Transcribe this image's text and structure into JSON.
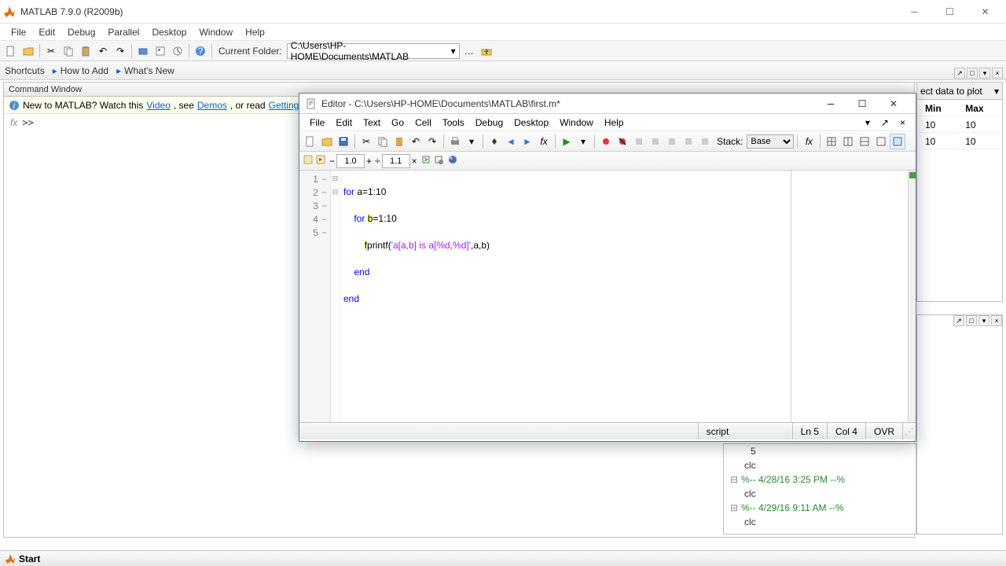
{
  "app": {
    "title": "MATLAB 7.9.0 (R2009b)"
  },
  "main_menu": [
    "File",
    "Edit",
    "Debug",
    "Parallel",
    "Desktop",
    "Window",
    "Help"
  ],
  "toolbar": {
    "current_folder_label": "Current Folder:",
    "current_folder_path": "C:\\Users\\HP-HOME\\Documents\\MATLAB"
  },
  "shortcuts": {
    "label": "Shortcuts",
    "how_to_add": "How to Add",
    "whats_new": "What's New"
  },
  "command_window": {
    "title": "Command Window",
    "info_prefix": "New to MATLAB? Watch this ",
    "info_video": "Video",
    "info_see": ", see ",
    "info_demos": "Demos",
    "info_or": ", or read ",
    "info_getting_started": "Getting Started",
    "info_period": ".",
    "prompt": ">>"
  },
  "right_panel": {
    "select_label": "ect data to plot",
    "cols": [
      "Min",
      "Max"
    ],
    "rows": [
      [
        "10",
        "10"
      ],
      [
        "10",
        "10"
      ]
    ]
  },
  "editor": {
    "title": "Editor - C:\\Users\\HP-HOME\\Documents\\MATLAB\\first.m*",
    "menu": [
      "File",
      "Edit",
      "Text",
      "Go",
      "Cell",
      "Tools",
      "Debug",
      "Desktop",
      "Window",
      "Help"
    ],
    "stack_label": "Stack:",
    "stack_value": "Base",
    "zoom1": "1.0",
    "zoom2": "1.1",
    "code": {
      "lines": [
        {
          "n": "1",
          "text": "for a=1:10",
          "indent": 0,
          "fold": "⊟"
        },
        {
          "n": "2",
          "text": "for b=1:10",
          "indent": 1,
          "fold": "⊟"
        },
        {
          "n": "3",
          "text": "fprintf('a[a,b] is a[%d,%d]',a,b)",
          "indent": 2,
          "fold": ""
        },
        {
          "n": "4",
          "text": "end",
          "indent": 1,
          "fold": ""
        },
        {
          "n": "5",
          "text": "end",
          "indent": 0,
          "fold": ""
        }
      ]
    },
    "status": {
      "type": "script",
      "line": "Ln  5",
      "col": "Col  4",
      "ovr": "OVR"
    }
  },
  "history": [
    {
      "type": "val",
      "text": "5"
    },
    {
      "type": "cmd",
      "text": "clc"
    },
    {
      "type": "date",
      "text": "%-- 4/28/16  3:25 PM --%"
    },
    {
      "type": "cmd",
      "text": "clc"
    },
    {
      "type": "date",
      "text": "%-- 4/29/16  9:11 AM --%"
    },
    {
      "type": "cmd",
      "text": "clc"
    }
  ],
  "start": "Start"
}
